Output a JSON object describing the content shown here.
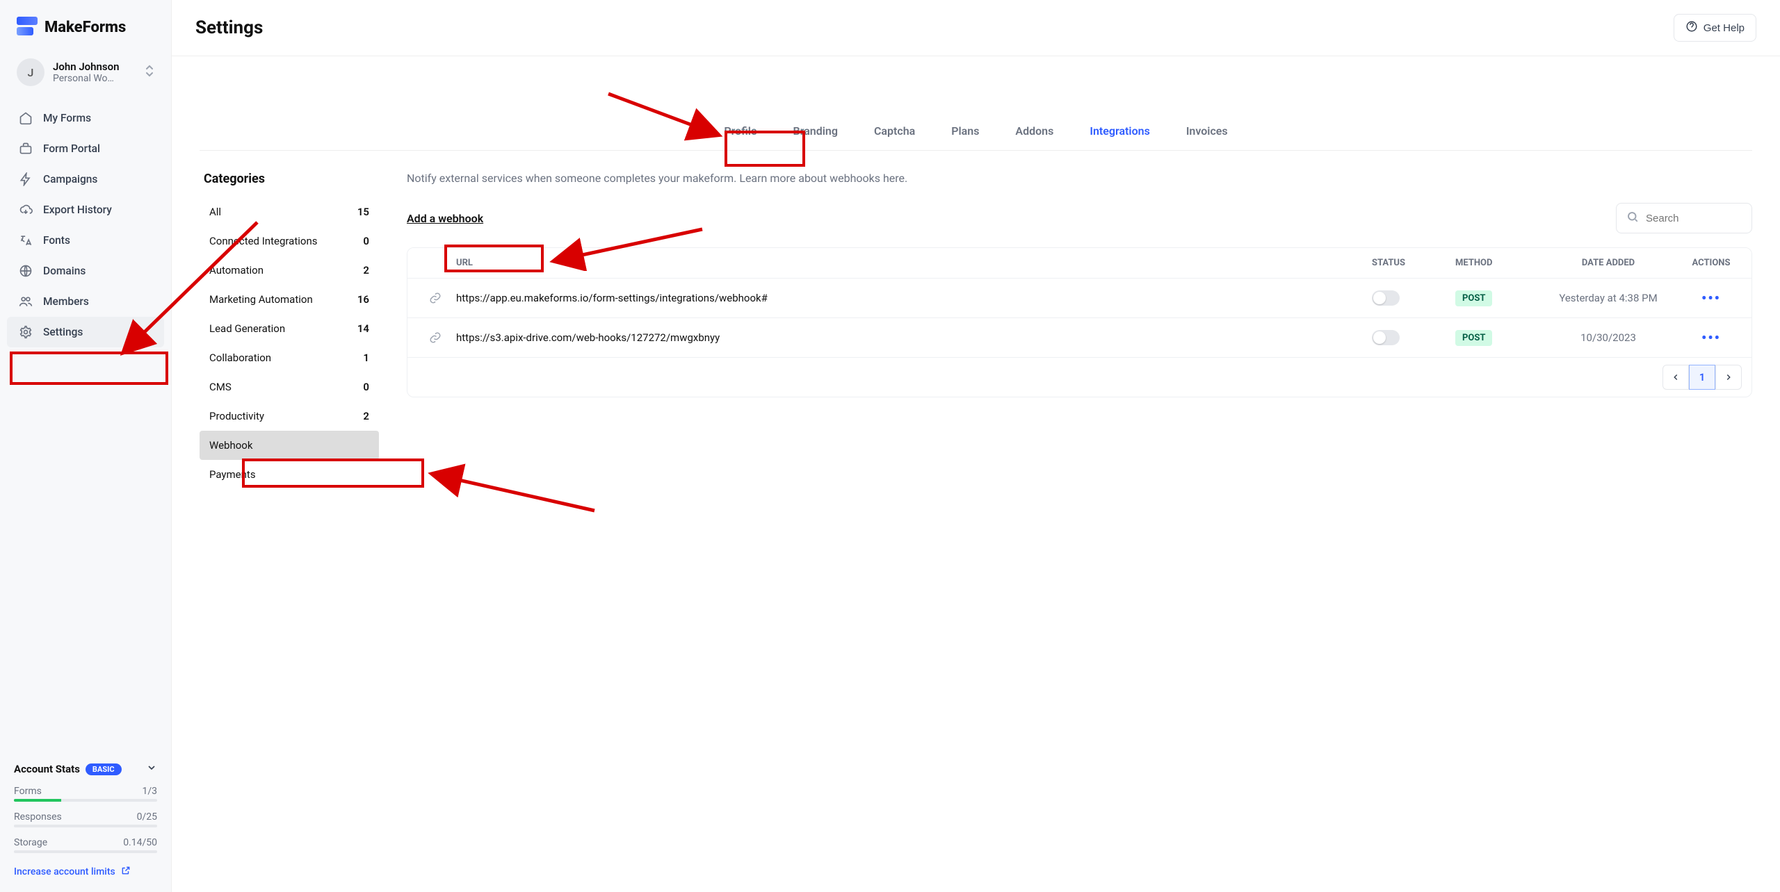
{
  "brand": {
    "name": "MakeForms"
  },
  "workspace": {
    "initial": "J",
    "name": "John Johnson",
    "sub": "Personal Wo…"
  },
  "sidebar": {
    "items": [
      {
        "label": "My Forms"
      },
      {
        "label": "Form Portal"
      },
      {
        "label": "Campaigns"
      },
      {
        "label": "Export History"
      },
      {
        "label": "Fonts"
      },
      {
        "label": "Domains"
      },
      {
        "label": "Members"
      },
      {
        "label": "Settings"
      }
    ],
    "active_index": 7
  },
  "stats": {
    "title": "Account Stats",
    "pill": "BASIC",
    "rows": [
      {
        "label": "Forms",
        "value": "1/3",
        "pct": 33
      },
      {
        "label": "Responses",
        "value": "0/25",
        "pct": 0
      },
      {
        "label": "Storage",
        "value": "0.14/50",
        "pct": 0
      }
    ],
    "link": "Increase account limits"
  },
  "header": {
    "title": "Settings",
    "help": "Get Help"
  },
  "tabs": {
    "items": [
      "Profile",
      "Branding",
      "Captcha",
      "Plans",
      "Addons",
      "Integrations",
      "Invoices"
    ],
    "active_index": 5
  },
  "categories": {
    "title": "Categories",
    "items": [
      {
        "label": "All",
        "count": "15"
      },
      {
        "label": "Connected Integrations",
        "count": "0"
      },
      {
        "label": "Automation",
        "count": "2"
      },
      {
        "label": "Marketing Automation",
        "count": "16"
      },
      {
        "label": "Lead Generation",
        "count": "14"
      },
      {
        "label": "Collaboration",
        "count": "1"
      },
      {
        "label": "CMS",
        "count": "0"
      },
      {
        "label": "Productivity",
        "count": "2"
      },
      {
        "label": "Webhook",
        "count": ""
      },
      {
        "label": "Payments",
        "count": ""
      }
    ],
    "active_index": 8
  },
  "panel": {
    "notify": "Notify external services when someone completes your makeform. Learn more about webhooks here.",
    "add_link": "Add a webhook",
    "search_placeholder": "Search",
    "columns": {
      "url": "URL",
      "status": "STATUS",
      "method": "METHOD",
      "date": "DATE ADDED",
      "actions": "ACTIONS"
    },
    "rows": [
      {
        "url": "https://app.eu.makeforms.io/form-settings/integrations/webhook#",
        "method": "POST",
        "date": "Yesterday at 4:38 PM"
      },
      {
        "url": "https://s3.apix-drive.com/web-hooks/127272/mwgxbnyy",
        "method": "POST",
        "date": "10/30/2023"
      }
    ],
    "page": "1"
  }
}
